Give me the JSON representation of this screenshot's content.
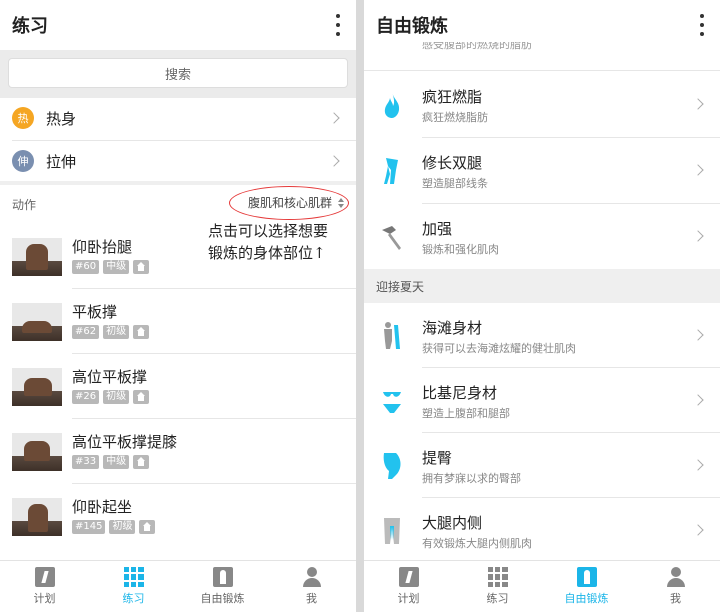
{
  "left": {
    "title": "练习",
    "search_placeholder": "搜索",
    "quick_items": [
      {
        "badge": "热",
        "label": "热身",
        "color": "#f5a623"
      },
      {
        "badge": "伸",
        "label": "拉伸",
        "color": "#7a8fb0"
      }
    ],
    "section_label": "动作",
    "filter_label": "腹肌和核心肌群",
    "annotation_line1": "点击可以选择想要",
    "annotation_line2": "锻炼的身体部位↑",
    "exercises": [
      {
        "name": "仰卧抬腿",
        "num": "#60",
        "level": "中级"
      },
      {
        "name": "平板撑",
        "num": "#62",
        "level": "初级"
      },
      {
        "name": "高位平板撑",
        "num": "#26",
        "level": "初级"
      },
      {
        "name": "高位平板撑提膝",
        "num": "#33",
        "level": "中级"
      },
      {
        "name": "仰卧起坐",
        "num": "#145",
        "level": "初级"
      }
    ],
    "nav": [
      {
        "label": "计划",
        "icon": "plan-icon"
      },
      {
        "label": "练习",
        "icon": "grid-icon",
        "active": true
      },
      {
        "label": "自由锻炼",
        "icon": "person-icon"
      },
      {
        "label": "我",
        "icon": "profile-icon"
      }
    ]
  },
  "right": {
    "title": "自由锻炼",
    "partial_top_text": "感受腹部的燃烧的脂肪",
    "group1": [
      {
        "name": "疯狂燃脂",
        "desc": "疯狂燃烧脂肪",
        "icon": "flame-icon"
      },
      {
        "name": "修长双腿",
        "desc": "塑造腿部线条",
        "icon": "legs-icon"
      },
      {
        "name": "加强",
        "desc": "锻炼和强化肌肉",
        "icon": "hammer-icon"
      }
    ],
    "section_title": "迎接夏天",
    "group2": [
      {
        "name": "海滩身材",
        "desc": "获得可以去海滩炫耀的健壮肌肉",
        "icon": "body-icon"
      },
      {
        "name": "比基尼身材",
        "desc": "塑造上腹部和腿部",
        "icon": "bikini-icon"
      },
      {
        "name": "提臀",
        "desc": "拥有梦寐以求的臀部",
        "icon": "hip-icon"
      },
      {
        "name": "大腿内侧",
        "desc": "有效锻炼大腿内侧肌肉",
        "icon": "thigh-icon"
      }
    ],
    "nav": [
      {
        "label": "计划",
        "icon": "plan-icon"
      },
      {
        "label": "练习",
        "icon": "grid-icon"
      },
      {
        "label": "自由锻炼",
        "icon": "person-icon",
        "active": true
      },
      {
        "label": "我",
        "icon": "profile-icon"
      }
    ]
  },
  "colors": {
    "accent": "#1bb5e8",
    "icon_cyan": "#22c2ee",
    "annotation_circle": "#e53a3a"
  }
}
